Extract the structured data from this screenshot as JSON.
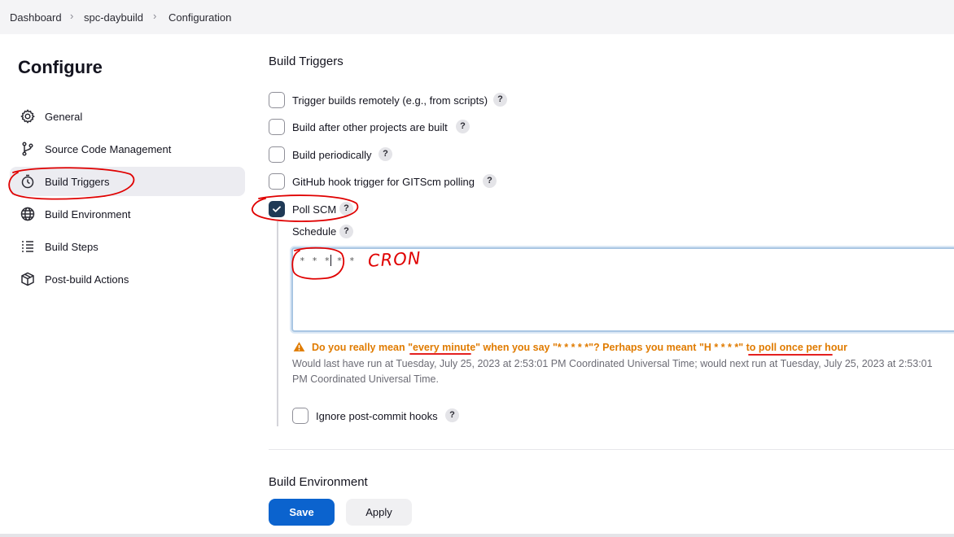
{
  "breadcrumb": [
    "Dashboard",
    "spc-daybuild",
    "Configuration"
  ],
  "sidebar": {
    "title": "Configure",
    "items": [
      {
        "label": "General",
        "icon": "gear-icon"
      },
      {
        "label": "Source Code Management",
        "icon": "branch-icon"
      },
      {
        "label": "Build Triggers",
        "icon": "clock-icon",
        "active": true
      },
      {
        "label": "Build Environment",
        "icon": "globe-icon"
      },
      {
        "label": "Build Steps",
        "icon": "list-icon"
      },
      {
        "label": "Post-build Actions",
        "icon": "package-icon"
      }
    ]
  },
  "main": {
    "section_title": "Build Triggers",
    "triggers": [
      {
        "label": "Trigger builds remotely (e.g., from scripts)",
        "checked": false
      },
      {
        "label": "Build after other projects are built",
        "checked": false
      },
      {
        "label": "Build periodically",
        "checked": false
      },
      {
        "label": "GitHub hook trigger for GITScm polling",
        "checked": false
      },
      {
        "label": "Poll SCM",
        "checked": true
      }
    ],
    "help_glyph": "?",
    "schedule": {
      "label": "Schedule",
      "value": "* * * * *",
      "annotation": "CRON",
      "warning": "Do you really mean \"every minute\" when you say \"* * * * *\"? Perhaps you meant \"H * * * *\" to poll once per hour",
      "info": "Would last have run at Tuesday, July 25, 2023 at 2:53:01 PM Coordinated Universal Time; would next run at Tuesday, July 25, 2023 at 2:53:01 PM Coordinated Universal Time."
    },
    "ignore_hooks": {
      "label": "Ignore post-commit hooks",
      "checked": false
    },
    "next_section_title": "Build Environment"
  },
  "actions": {
    "save_label": "Save",
    "apply_label": "Apply"
  },
  "colors": {
    "primary": "#0b63ce",
    "checkbox_checked": "#1f3a56",
    "warning": "#e07b00",
    "annotation": "#e00000"
  }
}
